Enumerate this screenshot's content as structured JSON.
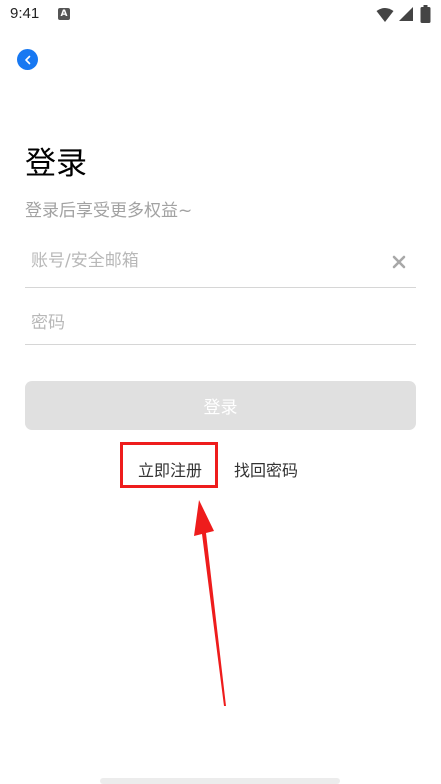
{
  "status_bar": {
    "time": "9:41",
    "notification_letter": "A",
    "icons": [
      "wifi-icon",
      "signal-icon",
      "battery-icon"
    ]
  },
  "header": {
    "back_icon": "chevron-left-icon",
    "accent_color": "#1778f2"
  },
  "login": {
    "title": "登录",
    "subtitle": "登录后享受更多权益~",
    "account_placeholder": "账号/安全邮箱",
    "account_value": "",
    "clear_icon": "close-icon",
    "password_placeholder": "密码",
    "password_value": "",
    "submit_label": "登录",
    "register_link": "立即注册",
    "forgot_link": "找回密码"
  },
  "annotation": {
    "highlight_color": "#ee1c1c",
    "arrow_color": "#ee1c1c"
  }
}
